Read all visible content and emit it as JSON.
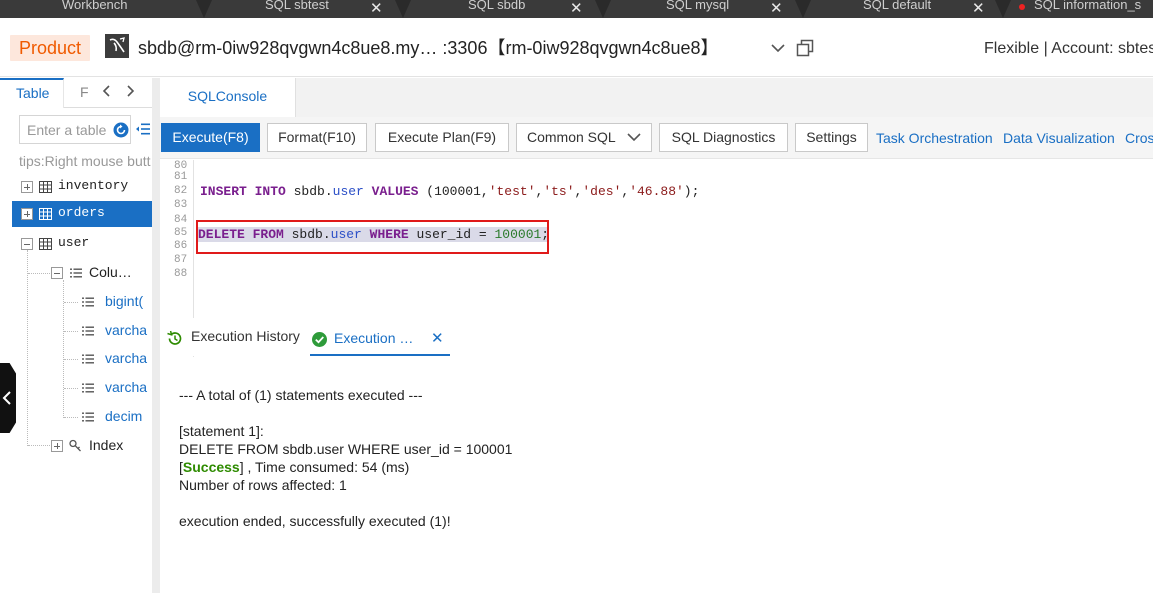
{
  "window_tabs": [
    {
      "label": "Workbench",
      "closable": false
    },
    {
      "label": "SQL sbtest",
      "closable": true
    },
    {
      "label": "SQL sbdb",
      "closable": true
    },
    {
      "label": "SQL mysql",
      "closable": true
    },
    {
      "label": "SQL default",
      "closable": true
    },
    {
      "label": "SQL information_s",
      "closable": false
    }
  ],
  "close_glyph": "✕",
  "header": {
    "product_label": "Product",
    "connection_title": "sbdb@rm-0iw928qvgwn4c8ue8.my… :3306【rm-0iw928qvgwn4c8ue8】",
    "mode_account": "Flexible | Account: sbtes"
  },
  "left_panel": {
    "tabs": [
      {
        "label": "Table",
        "active": true
      },
      {
        "label": "F",
        "active": false
      }
    ],
    "search_placeholder": "Enter a table",
    "tips": "tips:Right mouse butt",
    "tables": [
      {
        "name": "inventory",
        "expanded": false,
        "selected": false
      },
      {
        "name": "orders",
        "expanded": false,
        "selected": true
      },
      {
        "name": "user",
        "expanded": true,
        "selected": false
      }
    ],
    "columns_node": "Colu…",
    "columns": [
      "bigint(",
      "varcha",
      "varcha",
      "varcha",
      "decim"
    ],
    "index_node": "Index"
  },
  "console": {
    "tab_label": "SQLConsole",
    "toolbar": {
      "execute": "Execute(F8)",
      "format": "Format(F10)",
      "plan": "Execute Plan(F9)",
      "common_sql": "Common SQL",
      "diagnostics": "SQL Diagnostics",
      "settings": "Settings",
      "links": [
        "Task Orchestration",
        "Data Visualization",
        "Cros"
      ]
    },
    "line_numbers": [
      "80",
      "81",
      "82",
      "83",
      "84",
      "85",
      "86",
      "87",
      "88"
    ],
    "insert_sql": {
      "kw1": "INSERT INTO",
      "schema": " sbdb.",
      "table": "user",
      "kw2": " VALUES ",
      "open": "(100001,",
      "s1": "'test'",
      "c1": ",",
      "s2": "'ts'",
      "c2": ",",
      "s3": "'des'",
      "c3": ",",
      "s4": "'46.88'",
      "close": ");"
    },
    "delete_sql": {
      "kw1": "DELETE FROM",
      "schema": " sbdb.",
      "table": "user",
      "kw2": " WHERE ",
      "cond": "user_id = ",
      "value": "100001",
      "end": ";"
    }
  },
  "results": {
    "history_tab": "Execution History",
    "exec_tab": "Execution …",
    "summary": "--- A total of (1) statements executed ---",
    "statement_label": "[statement 1]:",
    "statement_sql": "DELETE FROM sbdb.user WHERE user_id = 100001",
    "bracket_open": "[",
    "success_word": "Success",
    "time_consumed": "] , Time consumed: 54 (ms)",
    "rows_affected": "Number of rows affected: 1",
    "ended": "execution ended, successfully executed (1)!"
  },
  "colors": {
    "accent": "#1a6fc4",
    "product": "#f05a00",
    "highlight_box": "#e01a1a",
    "success": "#2e8b00"
  }
}
